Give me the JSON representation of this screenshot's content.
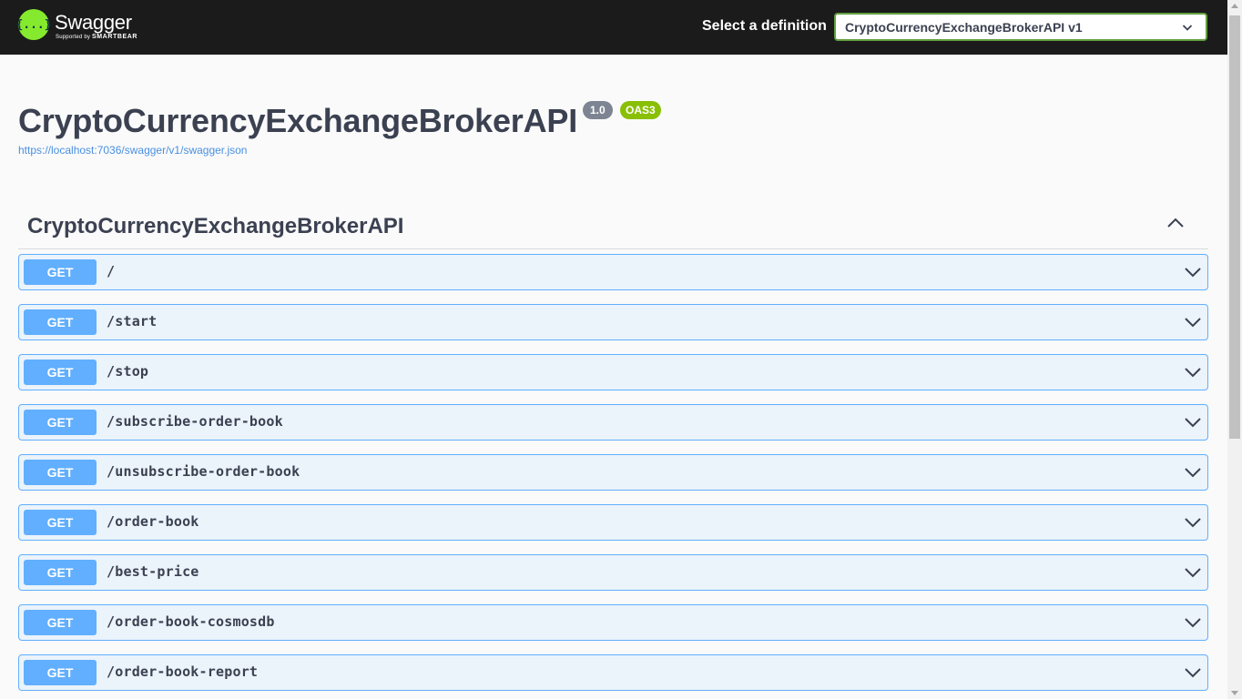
{
  "topbar": {
    "logo": {
      "icon_glyph": "{...}",
      "name": "Swagger",
      "sub_prefix": "Supported by ",
      "sub_brand": "SMARTBEAR"
    },
    "definition_label": "Select a definition",
    "definition_selected": "CryptoCurrencyExchangeBrokerAPI v1"
  },
  "info": {
    "title": "CryptoCurrencyExchangeBrokerAPI",
    "version": "1.0",
    "oas": "OAS3",
    "spec_url": "https://localhost:7036/swagger/v1/swagger.json"
  },
  "tag": {
    "name": "CryptoCurrencyExchangeBrokerAPI",
    "expanded": true
  },
  "operations": [
    {
      "method": "GET",
      "path": "/"
    },
    {
      "method": "GET",
      "path": "/start"
    },
    {
      "method": "GET",
      "path": "/stop"
    },
    {
      "method": "GET",
      "path": "/subscribe-order-book"
    },
    {
      "method": "GET",
      "path": "/unsubscribe-order-book"
    },
    {
      "method": "GET",
      "path": "/order-book"
    },
    {
      "method": "GET",
      "path": "/best-price"
    },
    {
      "method": "GET",
      "path": "/order-book-cosmosdb"
    },
    {
      "method": "GET",
      "path": "/order-book-report"
    }
  ],
  "colors": {
    "topbar": "#1b1b1b",
    "logo_green": "#85ea2d",
    "get_method": "#61affe",
    "get_background": "#ebf3fb",
    "oas_badge": "#89bf04",
    "version_badge": "#7d8492",
    "link": "#4990e2"
  },
  "icons": {
    "definition_dropdown": "chevron-down-icon",
    "tag_toggle": "chevron-up-icon",
    "operation_expand": "chevron-down-icon"
  }
}
